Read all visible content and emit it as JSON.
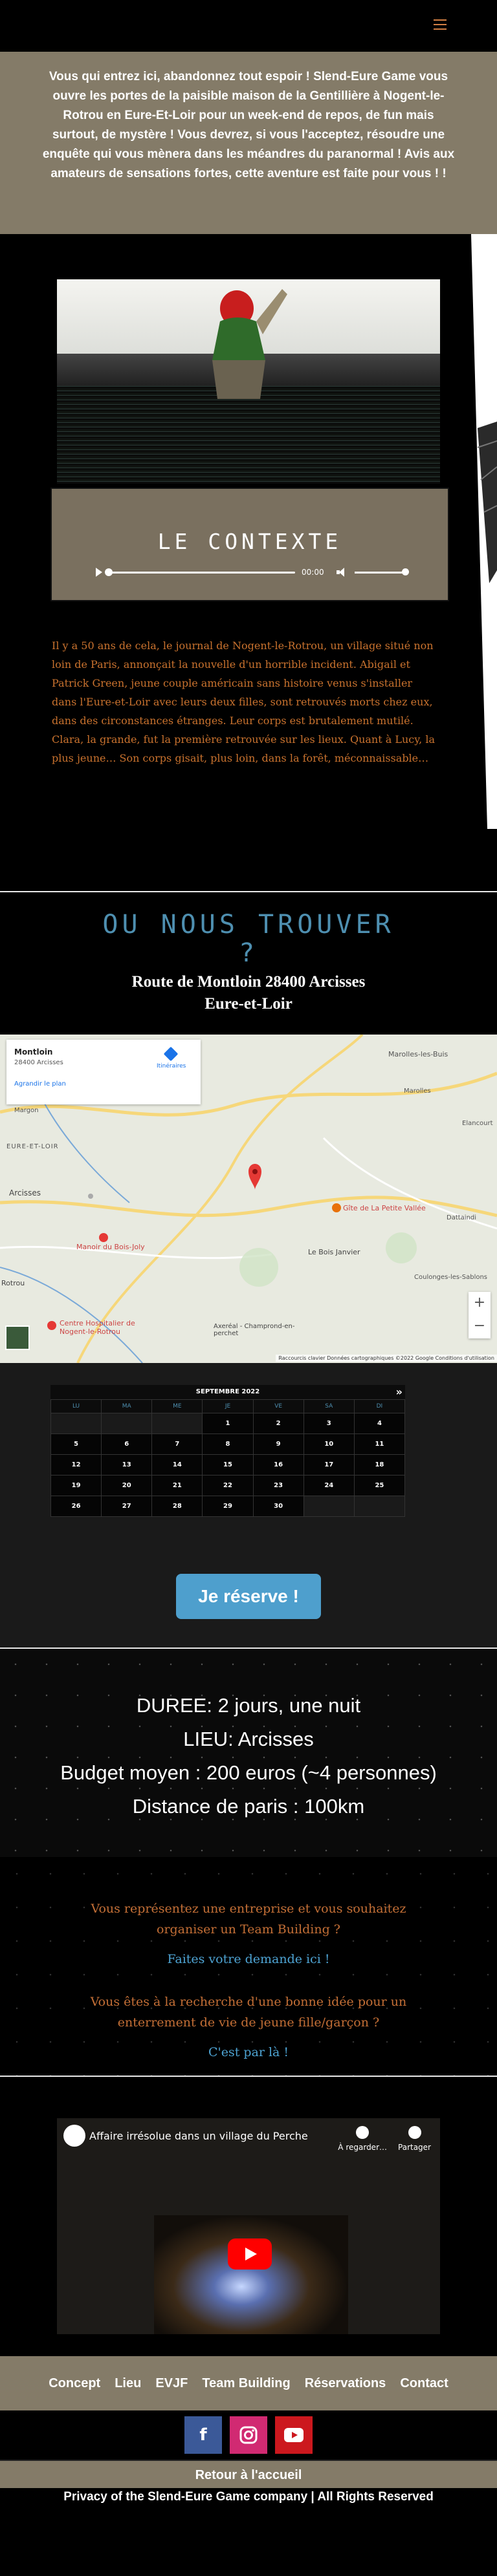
{
  "header": {
    "menu_icon": "hamburger-icon"
  },
  "intro": {
    "text": "Vous qui entrez ici, abandonnez tout espoir ! Slend-Eure Game vous ouvre les portes de la paisible maison de la Gentillière à Nogent-le-Rotrou en Eure-Et-Loir pour un week-end de repos, de fun mais surtout, de mystère ! Vous devrez, si vous l'acceptez, résoudre une enquête qui vous mènera dans les méandres du paranormal ! Avis aux amateurs de sensations fortes, cette aventure est faite pour vous ! !"
  },
  "context": {
    "title": "LE CONTEXTE",
    "audio_time": "00:00",
    "text": "Il y a 50 ans de cela, le journal de Nogent-le-Rotrou, un village situé non loin de Paris, annonçait la nouvelle d'un horrible incident. Abigail et Patrick Green, jeune couple américain sans histoire venus s'installer dans l'Eure-et-Loir avec leurs deux filles, sont retrouvés morts chez eux, dans des circonstances étranges. Leur corps est brutalement mutilé. Clara, la grande, fut la première retrouvée sur les lieux. Quant à Lucy, la plus jeune… Son corps gisait, plus loin, dans la forêt, méconnaissable…"
  },
  "location": {
    "title_line1": "OU NOUS TROUVER",
    "title_line2": "?",
    "address_line1": "Route de Montloin 28400 Arcisses",
    "address_line2": "Eure-et-Loir"
  },
  "map": {
    "place_name": "Montloin",
    "place_addr": "28400 Arcisses",
    "enlarge": "Agrandir le plan",
    "directions": "Itinéraires",
    "zoom_in": "+",
    "zoom_out": "−",
    "labels": [
      "Margon",
      "Marolles-les-Buis",
      "Arcisses",
      "Manoir du Bois-Joly",
      "Gîte de La Petite Vallée",
      "Le Bois Janvier",
      "Centre Hospitalier de Nogent-le-Rotrou",
      "Axeréal - Champrond-en-perchet",
      "Coulonges-les-Sablons",
      "Dattaindi",
      "Rotrou",
      "EURE-ET-LOIR",
      "Marolles",
      "Elancourt"
    ],
    "footer": "Raccourcis clavier   Données cartographiques ©2022 Google   Conditions d'utilisation"
  },
  "calendar": {
    "month": "SEPTEMBRE 2022",
    "next": "»",
    "days": [
      "LU",
      "MA",
      "ME",
      "JE",
      "VE",
      "SA",
      "DI"
    ],
    "weeks": [
      [
        "",
        "",
        "",
        "1",
        "2",
        "3",
        "4"
      ],
      [
        "5",
        "6",
        "7",
        "8",
        "9",
        "10",
        "11"
      ],
      [
        "12",
        "13",
        "14",
        "15",
        "16",
        "17",
        "18"
      ],
      [
        "19",
        "20",
        "21",
        "22",
        "23",
        "24",
        "25"
      ],
      [
        "26",
        "27",
        "28",
        "29",
        "30",
        "",
        ""
      ]
    ],
    "reserve_label": "Je réserve !"
  },
  "info": {
    "duree": "DUREE: 2 jours, une nuit",
    "lieu": "LIEU: Arcisses",
    "budget": "Budget moyen : 200 euros (~4 personnes)",
    "distance": "Distance de paris : 100km"
  },
  "offers": {
    "team_text": "Vous représentez une entreprise et vous souhaitez organiser un Team Building ?",
    "team_link": "Faites votre demande ici !",
    "evjf_text": "Vous êtes à la recherche d'une bonne idée pour un enterrement de vie de jeune fille/garçon ?",
    "evjf_link": "C'est par là !"
  },
  "video": {
    "title": "Affaire irrésolue dans un village du Perche",
    "watch_later": "À regarder…",
    "share": "Partager"
  },
  "footer": {
    "nav": [
      "Concept",
      "Lieu",
      "EVJF",
      "Team Building",
      "Réservations",
      "Contact"
    ],
    "social": [
      "facebook-icon",
      "instagram-icon",
      "youtube-icon"
    ],
    "back": "Retour à l'accueil",
    "copyright": "Privacy of the Slend-Eure Game company  | All Rights Reserved"
  },
  "colors": {
    "accent": "#847b68",
    "orange": "#c9722e",
    "blue": "#4e8fb0"
  }
}
